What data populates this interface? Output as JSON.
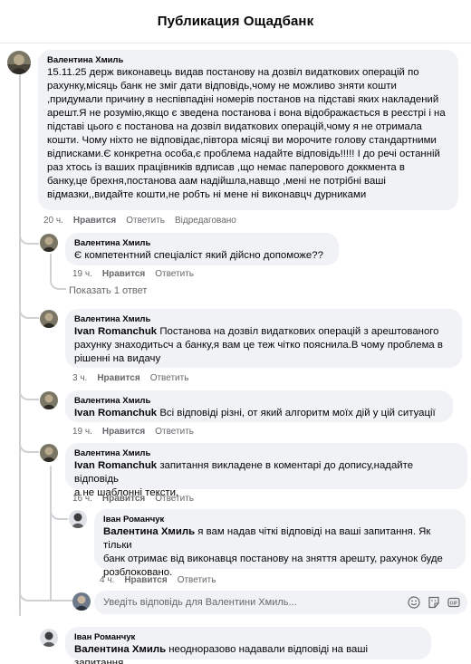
{
  "header": {
    "title": "Публикация Ощадбанк"
  },
  "main_comment": {
    "author": "Валентина Хмиль",
    "lines": [
      "15.11.25 держ виконавець видав постанову на дозвіл видаткових операцій по",
      "рахунку,місяць банк не зміг дати відповідь,чому не можливо зняти кошти",
      ",придумали причину в неспівпадіні номерів постанов на підставі яких накладений",
      "арешт.Я не розумію,якщо є зведена постанова і вона відображається в реєстрі і на",
      "підставі цього є постанова на дозвіл видаткових операцій,чому я не отримала",
      "кошти. Чому ніхто не відповідає,півтора місяці ви морочите голову стандартними",
      "відписками.Є конкретна особа,є проблема надайте відповідь!!!!! І до речі останній",
      "раз хтось із ваших працівників вдписав ,що немає паперового доккмента в",
      "банку,це брехня,постанова аам надійшла,навщо ,мені не потрібні ваші",
      "відмазки,,видайте кошти,не робть ні мене ні виконавцч дурниками"
    ],
    "time": "20 ч.",
    "like": "Нравится",
    "reply": "Ответить",
    "edited": "Відредаговано"
  },
  "replies": [
    {
      "author": "Валентина Хмиль",
      "mention": "",
      "lines": [
        "Є компетентний спеціаліст який дійсно допоможе??"
      ],
      "time": "19 ч.",
      "like": "Нравится",
      "reply": "Ответить"
    },
    {
      "author": "Валентина Хмиль",
      "mention": "Ivan Romanchuk",
      "lines": [
        " Постанова на дозвіл видаткових операцій з арештованого",
        "рахунку знаходитьсч а банку,я вам це теж чітко пояснила.В чому проблема в",
        "рішенні на видачу"
      ],
      "time": "3 ч.",
      "like": "Нравится",
      "reply": "Ответить"
    },
    {
      "author": "Валентина Хмиль",
      "mention": "Ivan Romanchuk",
      "lines": [
        " Всі відповіді різні, от який алгоритм моїх дій у цій ситуації"
      ],
      "time": "19 ч.",
      "like": "Нравится",
      "reply": "Ответить"
    },
    {
      "author": "Валентина Хмиль",
      "mention": "Ivan Romanchuk",
      "lines": [
        " запитання викладене в коментарі до допису,надайте відповідь",
        "а не шаблонні тексти,"
      ],
      "time": "16 ч.",
      "like": "Нравится",
      "reply": "Ответить"
    }
  ],
  "show_replies": "Показать 1 ответ",
  "nested_reply": {
    "author": "Іван Романчук",
    "mention": "Валентина Хмиль",
    "lines": [
      " я вам надав чіткі відповіді на ваші запитання. Як тільки",
      "банк отримає від виконавця постанову на зняття арешту, рахунок буде",
      "розблоковано."
    ],
    "time": "4 ч.",
    "like": "Нравится",
    "reply": "Ответить"
  },
  "reply_input": {
    "placeholder": "Уведіть відповідь для Валентини Хмиль..."
  },
  "bottom_comment": {
    "author": "Іван Романчук",
    "mention": "Валентина Хмиль",
    "lines": [
      " неодноразово надавали відповіді на ваші запитання."
    ]
  },
  "colors": {
    "bubble": "#f0f2f5",
    "meta": "#65676b",
    "line": "#ced0d4"
  },
  "icons": [
    "person-avatar-icon",
    "emoji-icon",
    "sticker-icon",
    "gif-icon",
    "camera-icon"
  ]
}
